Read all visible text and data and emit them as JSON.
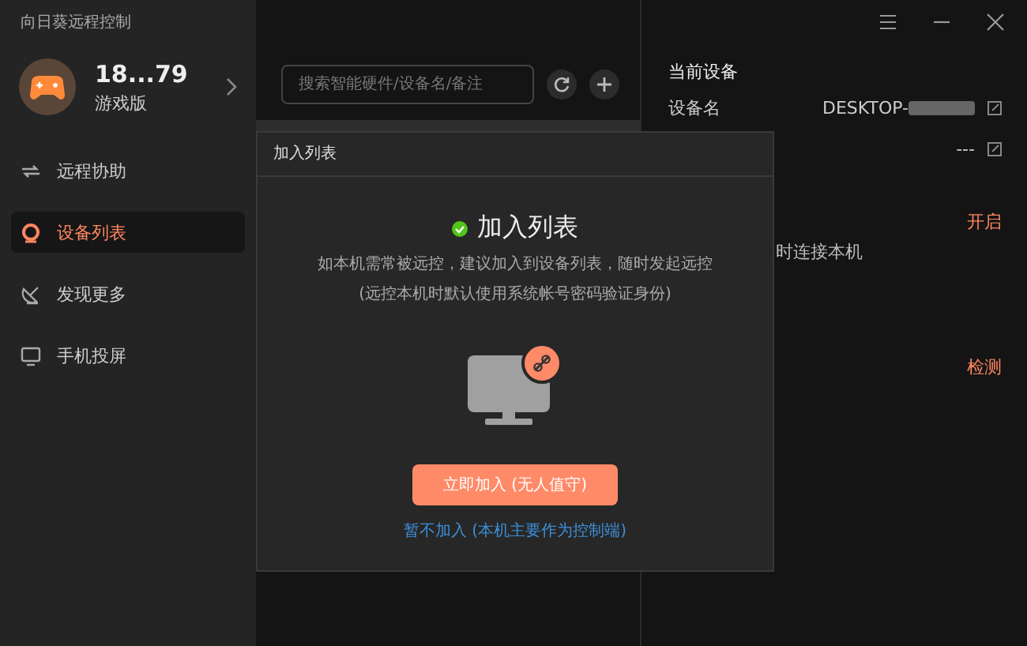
{
  "app": {
    "title": "向日葵远程控制"
  },
  "account": {
    "name": "18...79",
    "edition": "游戏版"
  },
  "sidebar": {
    "items": [
      {
        "label": "远程协助",
        "selected": false
      },
      {
        "label": "设备列表",
        "selected": true
      },
      {
        "label": "发现更多",
        "selected": false
      },
      {
        "label": "手机投屏",
        "selected": false
      }
    ]
  },
  "search": {
    "placeholder": "搜索智能硬件/设备名/备注"
  },
  "current_device": {
    "title": "当前设备",
    "rows": [
      {
        "label": "设备名",
        "value": "DESKTOP-"
      },
      {
        "value": "---"
      }
    ],
    "actions": [
      {
        "label": "开启",
        "note": "时连接本机"
      },
      {
        "label": "检测"
      }
    ]
  },
  "dialog": {
    "title": "加入列表",
    "heading": "加入列表",
    "message": "如本机需常被远控，建议加入到设备列表，随时发起远控",
    "note": "(远控本机时默认使用系统帐号密码验证身份)",
    "primary_button": "立即加入 (无人值守)",
    "secondary_link": "暂不加入 (本机主要作为控制端)"
  }
}
